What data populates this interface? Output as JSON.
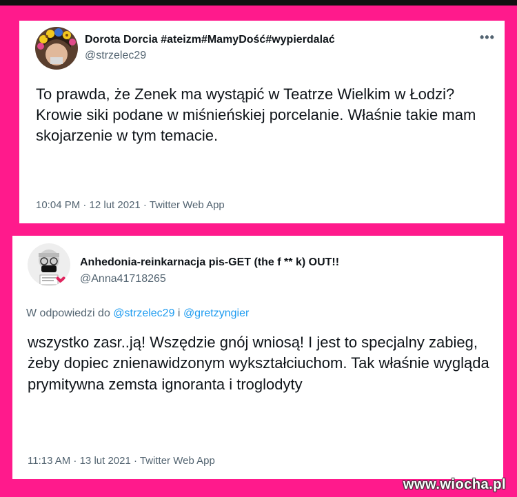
{
  "tweet1": {
    "display_name": "Dorota Dorcia #ateizm#MamyDość#wypierdalać",
    "handle": "@strzelec29",
    "more_icon": "•••",
    "text": "To prawda, że Zenek ma wystąpić w Teatrze Wielkim w Łodzi? Krowie siki podane w miśnieńskiej porcelanie. Właśnie takie mam skojarzenie w tym temacie.",
    "timestamp": "10:04 PM · 12 lut 2021 · Twitter Web App"
  },
  "tweet2": {
    "display_name": "Anhedonia-reinkarnacja pis-GET (the f ** k) OUT!!",
    "handle": "@Anna41718265",
    "reply_prefix": "W odpowiedzi do",
    "reply_user1": "@strzelec29",
    "reply_join": "i",
    "reply_user2": "@gretzyngier",
    "text": "wszystko zasr..ją! Wszędzie gnój wniosą! I jest to specjalny zabieg, żeby dopiec znienawidzonym wykształciuchom. Tak właśnie wygląda prymitywna zemsta ignoranta i troglodyty",
    "timestamp": "11:13 AM · 13 lut 2021 · Twitter Web App"
  },
  "watermark": "www.wiocha.pl",
  "colors": {
    "background": "#ff1a8c",
    "text": "#0f1419",
    "secondary": "#536471",
    "link": "#1d9bf0"
  }
}
